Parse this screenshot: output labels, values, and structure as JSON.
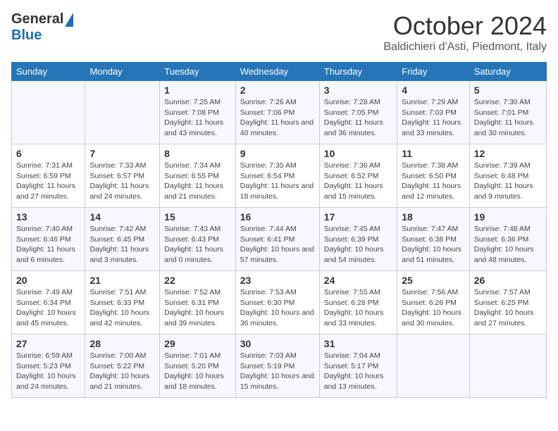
{
  "header": {
    "logo_general": "General",
    "logo_blue": "Blue",
    "month_title": "October 2024",
    "location": "Baldichieri d'Asti, Piedmont, Italy"
  },
  "days_of_week": [
    "Sunday",
    "Monday",
    "Tuesday",
    "Wednesday",
    "Thursday",
    "Friday",
    "Saturday"
  ],
  "weeks": [
    [
      {
        "day": "",
        "info": ""
      },
      {
        "day": "",
        "info": ""
      },
      {
        "day": "1",
        "sunrise": "Sunrise: 7:25 AM",
        "sunset": "Sunset: 7:08 PM",
        "daylight": "Daylight: 11 hours and 43 minutes."
      },
      {
        "day": "2",
        "sunrise": "Sunrise: 7:26 AM",
        "sunset": "Sunset: 7:06 PM",
        "daylight": "Daylight: 11 hours and 40 minutes."
      },
      {
        "day": "3",
        "sunrise": "Sunrise: 7:28 AM",
        "sunset": "Sunset: 7:05 PM",
        "daylight": "Daylight: 11 hours and 36 minutes."
      },
      {
        "day": "4",
        "sunrise": "Sunrise: 7:29 AM",
        "sunset": "Sunset: 7:03 PM",
        "daylight": "Daylight: 11 hours and 33 minutes."
      },
      {
        "day": "5",
        "sunrise": "Sunrise: 7:30 AM",
        "sunset": "Sunset: 7:01 PM",
        "daylight": "Daylight: 11 hours and 30 minutes."
      }
    ],
    [
      {
        "day": "6",
        "sunrise": "Sunrise: 7:31 AM",
        "sunset": "Sunset: 6:59 PM",
        "daylight": "Daylight: 11 hours and 27 minutes."
      },
      {
        "day": "7",
        "sunrise": "Sunrise: 7:33 AM",
        "sunset": "Sunset: 6:57 PM",
        "daylight": "Daylight: 11 hours and 24 minutes."
      },
      {
        "day": "8",
        "sunrise": "Sunrise: 7:34 AM",
        "sunset": "Sunset: 6:55 PM",
        "daylight": "Daylight: 11 hours and 21 minutes."
      },
      {
        "day": "9",
        "sunrise": "Sunrise: 7:35 AM",
        "sunset": "Sunset: 6:54 PM",
        "daylight": "Daylight: 11 hours and 18 minutes."
      },
      {
        "day": "10",
        "sunrise": "Sunrise: 7:36 AM",
        "sunset": "Sunset: 6:52 PM",
        "daylight": "Daylight: 11 hours and 15 minutes."
      },
      {
        "day": "11",
        "sunrise": "Sunrise: 7:38 AM",
        "sunset": "Sunset: 6:50 PM",
        "daylight": "Daylight: 11 hours and 12 minutes."
      },
      {
        "day": "12",
        "sunrise": "Sunrise: 7:39 AM",
        "sunset": "Sunset: 6:48 PM",
        "daylight": "Daylight: 11 hours and 9 minutes."
      }
    ],
    [
      {
        "day": "13",
        "sunrise": "Sunrise: 7:40 AM",
        "sunset": "Sunset: 6:46 PM",
        "daylight": "Daylight: 11 hours and 6 minutes."
      },
      {
        "day": "14",
        "sunrise": "Sunrise: 7:42 AM",
        "sunset": "Sunset: 6:45 PM",
        "daylight": "Daylight: 11 hours and 3 minutes."
      },
      {
        "day": "15",
        "sunrise": "Sunrise: 7:43 AM",
        "sunset": "Sunset: 6:43 PM",
        "daylight": "Daylight: 11 hours and 0 minutes."
      },
      {
        "day": "16",
        "sunrise": "Sunrise: 7:44 AM",
        "sunset": "Sunset: 6:41 PM",
        "daylight": "Daylight: 10 hours and 57 minutes."
      },
      {
        "day": "17",
        "sunrise": "Sunrise: 7:45 AM",
        "sunset": "Sunset: 6:39 PM",
        "daylight": "Daylight: 10 hours and 54 minutes."
      },
      {
        "day": "18",
        "sunrise": "Sunrise: 7:47 AM",
        "sunset": "Sunset: 6:38 PM",
        "daylight": "Daylight: 10 hours and 51 minutes."
      },
      {
        "day": "19",
        "sunrise": "Sunrise: 7:48 AM",
        "sunset": "Sunset: 6:36 PM",
        "daylight": "Daylight: 10 hours and 48 minutes."
      }
    ],
    [
      {
        "day": "20",
        "sunrise": "Sunrise: 7:49 AM",
        "sunset": "Sunset: 6:34 PM",
        "daylight": "Daylight: 10 hours and 45 minutes."
      },
      {
        "day": "21",
        "sunrise": "Sunrise: 7:51 AM",
        "sunset": "Sunset: 6:33 PM",
        "daylight": "Daylight: 10 hours and 42 minutes."
      },
      {
        "day": "22",
        "sunrise": "Sunrise: 7:52 AM",
        "sunset": "Sunset: 6:31 PM",
        "daylight": "Daylight: 10 hours and 39 minutes."
      },
      {
        "day": "23",
        "sunrise": "Sunrise: 7:53 AM",
        "sunset": "Sunset: 6:30 PM",
        "daylight": "Daylight: 10 hours and 36 minutes."
      },
      {
        "day": "24",
        "sunrise": "Sunrise: 7:55 AM",
        "sunset": "Sunset: 6:28 PM",
        "daylight": "Daylight: 10 hours and 33 minutes."
      },
      {
        "day": "25",
        "sunrise": "Sunrise: 7:56 AM",
        "sunset": "Sunset: 6:26 PM",
        "daylight": "Daylight: 10 hours and 30 minutes."
      },
      {
        "day": "26",
        "sunrise": "Sunrise: 7:57 AM",
        "sunset": "Sunset: 6:25 PM",
        "daylight": "Daylight: 10 hours and 27 minutes."
      }
    ],
    [
      {
        "day": "27",
        "sunrise": "Sunrise: 6:59 AM",
        "sunset": "Sunset: 5:23 PM",
        "daylight": "Daylight: 10 hours and 24 minutes."
      },
      {
        "day": "28",
        "sunrise": "Sunrise: 7:00 AM",
        "sunset": "Sunset: 5:22 PM",
        "daylight": "Daylight: 10 hours and 21 minutes."
      },
      {
        "day": "29",
        "sunrise": "Sunrise: 7:01 AM",
        "sunset": "Sunset: 5:20 PM",
        "daylight": "Daylight: 10 hours and 18 minutes."
      },
      {
        "day": "30",
        "sunrise": "Sunrise: 7:03 AM",
        "sunset": "Sunset: 5:19 PM",
        "daylight": "Daylight: 10 hours and 15 minutes."
      },
      {
        "day": "31",
        "sunrise": "Sunrise: 7:04 AM",
        "sunset": "Sunset: 5:17 PM",
        "daylight": "Daylight: 10 hours and 13 minutes."
      },
      {
        "day": "",
        "info": ""
      },
      {
        "day": "",
        "info": ""
      }
    ]
  ]
}
